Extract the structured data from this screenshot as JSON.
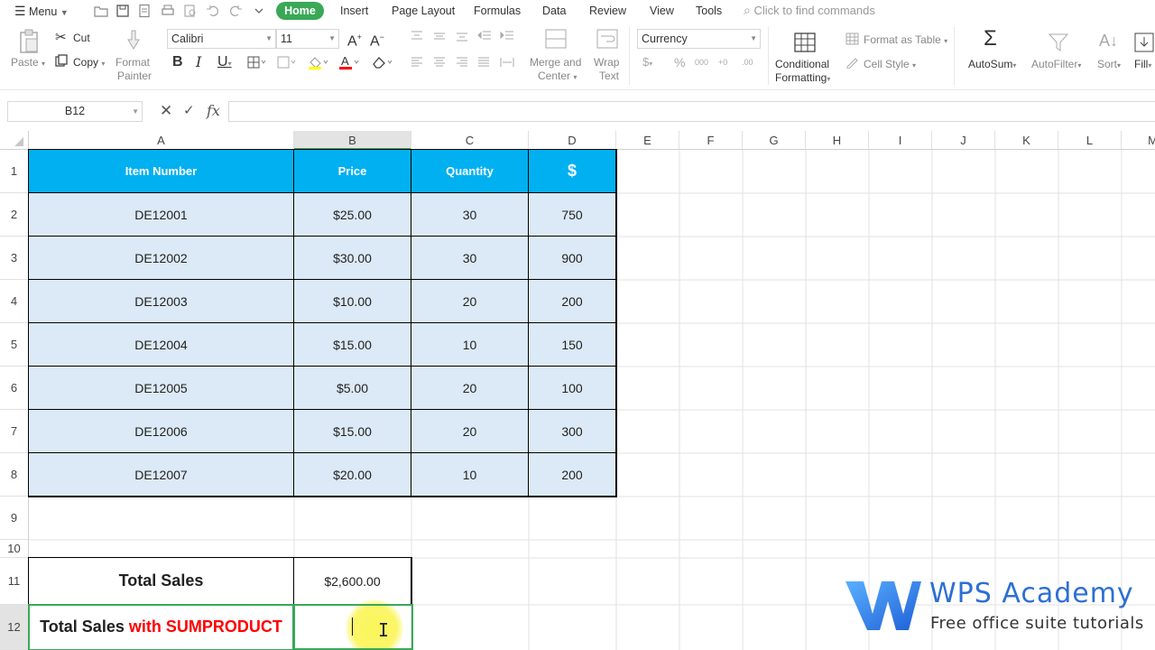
{
  "menubar": {
    "menu_label": "Menu",
    "tabs": [
      "Home",
      "Insert",
      "Page Layout",
      "Formulas",
      "Data",
      "Review",
      "View",
      "Tools"
    ],
    "search_placeholder": "Click to find commands"
  },
  "ribbon": {
    "paste": "Paste",
    "cut": "Cut",
    "copy": "Copy",
    "format_painter_1": "Format",
    "format_painter_2": "Painter",
    "font_name": "Calibri",
    "font_size": "11",
    "merge_1": "Merge and",
    "merge_2": "Center",
    "wrap_1": "Wrap",
    "wrap_2": "Text",
    "number_format": "Currency",
    "conditional_1": "Conditional",
    "conditional_2": "Formatting",
    "format_as_table": "Format as Table",
    "cell_style": "Cell Style",
    "autosum": "AutoSum",
    "autofilter": "AutoFilter",
    "sort": "Sort",
    "fill": "Fill"
  },
  "formula_bar": {
    "name_box": "B12",
    "content": ""
  },
  "columns": [
    "A",
    "B",
    "C",
    "D",
    "E",
    "F",
    "G",
    "H",
    "I",
    "J",
    "K",
    "L",
    "M"
  ],
  "rows": [
    "1",
    "2",
    "3",
    "4",
    "5",
    "6",
    "7",
    "8",
    "9",
    "10",
    "11",
    "12"
  ],
  "table": {
    "headers": [
      "Item Number",
      "Price",
      "Quantity",
      "$"
    ],
    "rows": [
      [
        "DE12001",
        "$25.00",
        "30",
        "750"
      ],
      [
        "DE12002",
        "$30.00",
        "30",
        "900"
      ],
      [
        "DE12003",
        "$10.00",
        "20",
        "200"
      ],
      [
        "DE12004",
        "$15.00",
        "10",
        "150"
      ],
      [
        "DE12005",
        "$5.00",
        "20",
        "100"
      ],
      [
        "DE12006",
        "$15.00",
        "20",
        "300"
      ],
      [
        "DE12007",
        "$20.00",
        "10",
        "200"
      ]
    ]
  },
  "totals": {
    "total_sales_label": "Total Sales",
    "total_sales_value": "$2,600.00",
    "sumproduct_label_black": "Total Sales",
    "sumproduct_label_red": "with SUMPRODUCT",
    "sumproduct_value": ""
  },
  "watermark": {
    "title": "WPS Academy",
    "subtitle": "Free office suite tutorials"
  },
  "colors": {
    "header_fill": "#00b0f0",
    "data_fill": "#dce9f6",
    "accent_green": "#3aa856",
    "red_text": "#ff0000"
  }
}
